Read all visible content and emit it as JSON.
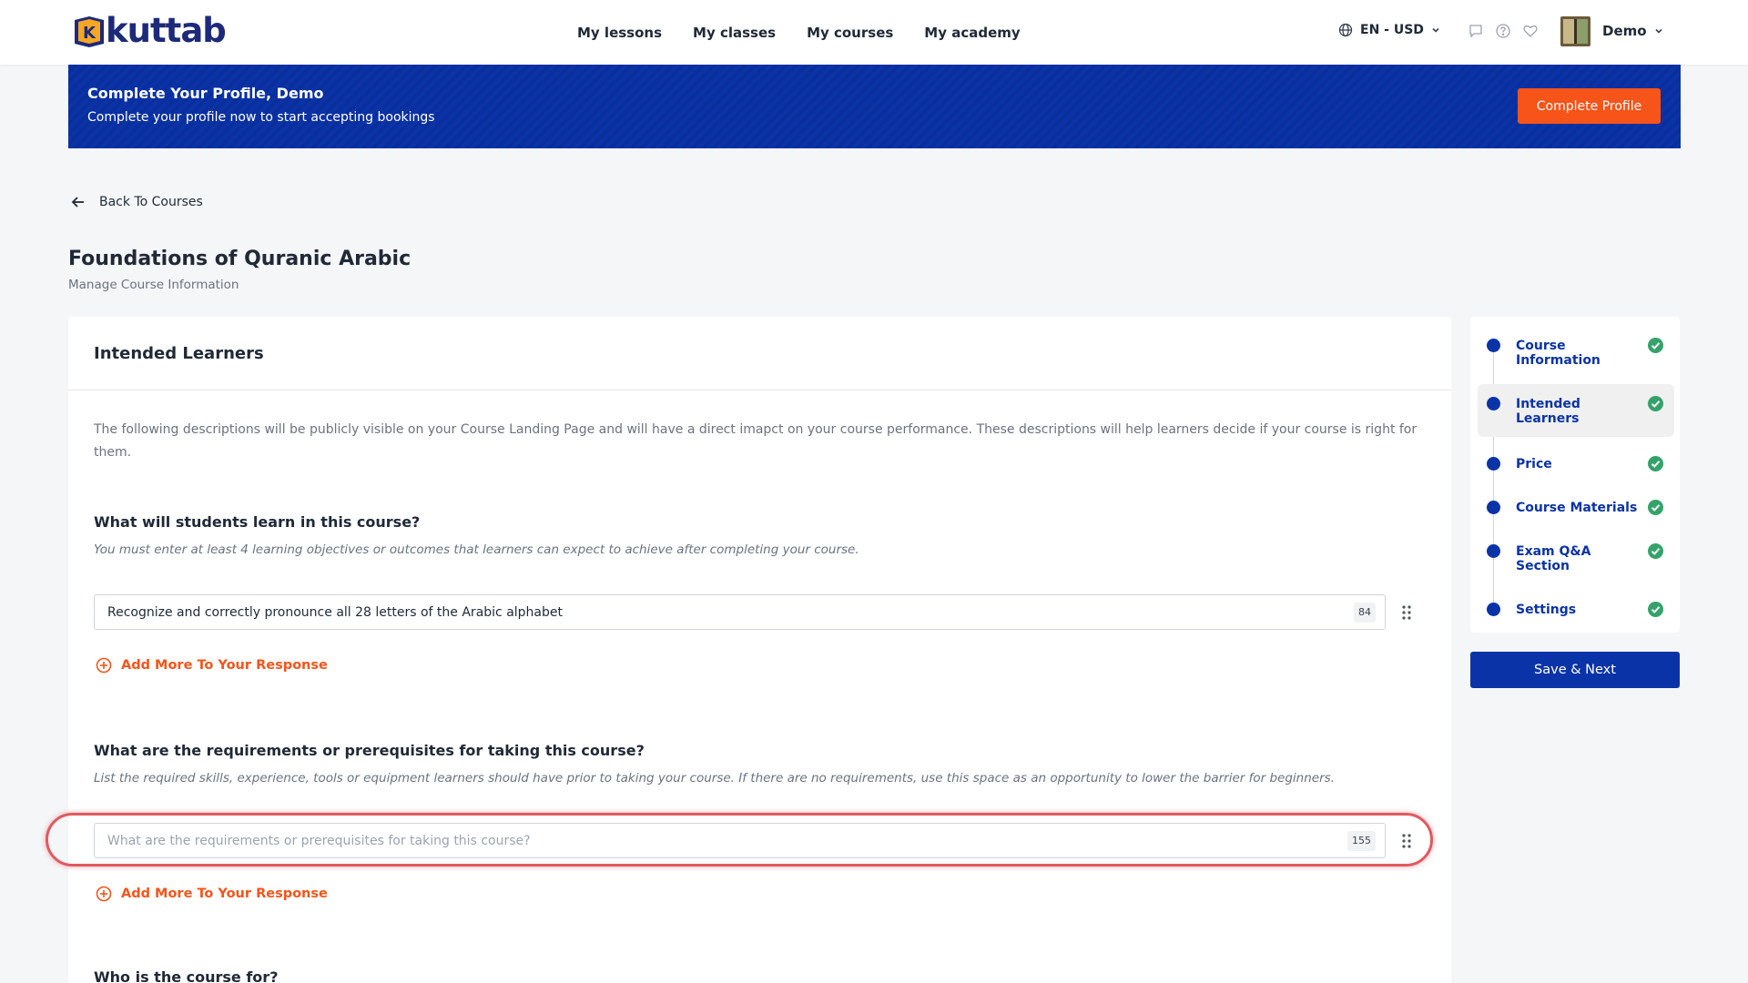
{
  "header": {
    "logo_text": "kuttab",
    "logo_letter": "K",
    "nav": [
      "My lessons",
      "My classes",
      "My courses",
      "My academy"
    ],
    "language": "EN - USD",
    "user_name": "Demo"
  },
  "banner": {
    "title": "Complete Your Profile, Demo",
    "subtitle": "Complete your profile now to start accepting bookings",
    "button": "Complete Profile"
  },
  "back_label": "Back To Courses",
  "page": {
    "title": "Foundations of Quranic Arabic",
    "subtitle": "Manage Course Information"
  },
  "card": {
    "title": "Intended Learners",
    "intro": "The following descriptions will be publicly visible on your Course Landing Page and will have a direct imapct on your course performance. These descriptions will help learners decide if your course is right for them.",
    "q1": {
      "title": "What will students learn in this course?",
      "hint": "You must enter at least 4 learning objectives or outcomes that learners can expect to achieve after completing your course.",
      "value": "Recognize and correctly pronounce all 28 letters of the Arabic alphabet",
      "count": "84",
      "add_more": "Add More To Your Response"
    },
    "q2": {
      "title": "What are the requirements or prerequisites for taking this course?",
      "hint": "List the required skills, experience, tools or equipment learners should have prior to taking your course. If there are no requirements, use this space as an opportunity to lower the barrier for beginners.",
      "placeholder": "What are the requirements or prerequisites for taking this course?",
      "count": "155",
      "add_more": "Add More To Your Response"
    },
    "q3": {
      "title": "Who is the course for?"
    }
  },
  "steps": [
    {
      "label": "Course Information",
      "done": true,
      "active": false
    },
    {
      "label": "Intended Learners",
      "done": true,
      "active": true
    },
    {
      "label": "Price",
      "done": true,
      "active": false
    },
    {
      "label": "Course Materials",
      "done": true,
      "active": false
    },
    {
      "label": "Exam Q&A Section",
      "done": true,
      "active": false
    },
    {
      "label": "Settings",
      "done": true,
      "active": false
    }
  ],
  "save_button": "Save & Next",
  "colors": {
    "brand_blue": "#0b33a8",
    "accent_orange": "#f7541a",
    "success_green": "#34a36a",
    "highlight_red": "#e05a5f"
  }
}
